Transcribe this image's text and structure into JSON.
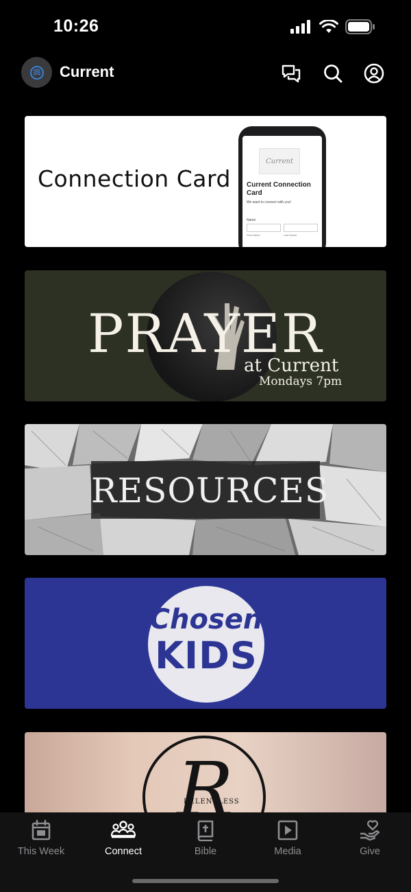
{
  "status_bar": {
    "time": "10:26"
  },
  "header": {
    "title": "Current",
    "icons": [
      "chat-bubbles-icon",
      "search-icon",
      "profile-icon"
    ]
  },
  "cards": {
    "connection": {
      "title": "Connection Card",
      "phone_logo": "Current",
      "phone_heading": "Current Connection Card",
      "phone_sub": "We want to connect with you!",
      "phone_name_label": "Name",
      "phone_first": "First Name",
      "phone_last": "Last Name"
    },
    "prayer": {
      "title": "PRAYER",
      "subtitle": "at Current",
      "time": "Mondays 7pm"
    },
    "resources": {
      "title": "RESOURCES"
    },
    "kids": {
      "line1": "Chosen",
      "line2": "KIDS"
    },
    "relentless": {
      "letter": "R",
      "word": "RELENTLESS"
    }
  },
  "tab_bar": {
    "tabs": [
      {
        "label": "This Week",
        "icon": "calendar-icon",
        "active": false
      },
      {
        "label": "Connect",
        "icon": "people-icon",
        "active": true
      },
      {
        "label": "Bible",
        "icon": "bible-icon",
        "active": false
      },
      {
        "label": "Media",
        "icon": "play-icon",
        "active": false
      },
      {
        "label": "Give",
        "icon": "give-heart-icon",
        "active": false
      }
    ]
  },
  "colors": {
    "background": "#000000",
    "prayer_bg": "#2c3123",
    "kids_bg": "#2d3594",
    "tab_inactive": "#8e8e93",
    "tab_active": "#ffffff"
  }
}
